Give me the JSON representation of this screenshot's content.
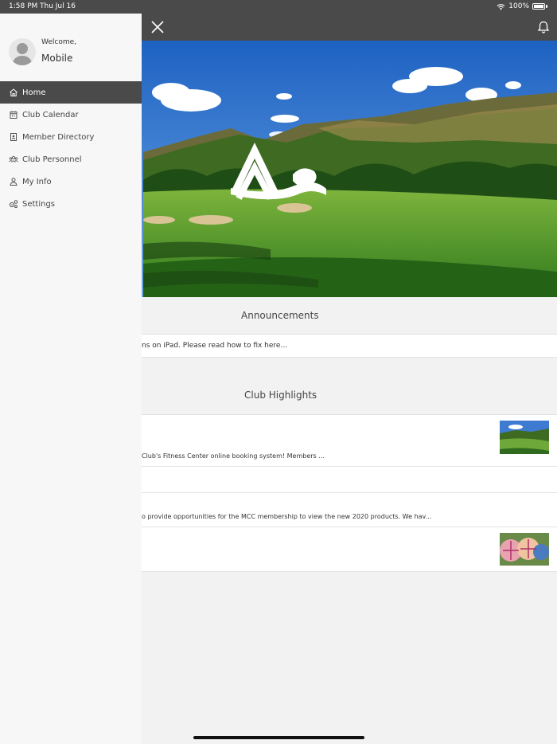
{
  "status_bar": {
    "time": "1:58 PM",
    "date": "Thu Jul 16",
    "battery": "100%"
  },
  "app_bar": {
    "close_icon": "close-icon",
    "notification_icon": "bell-icon"
  },
  "drawer": {
    "welcome": "Welcome,",
    "username": "Mobile",
    "items": [
      {
        "label": "Home",
        "icon": "home-icon",
        "active": true
      },
      {
        "label": "Club Calendar",
        "icon": "calendar-icon",
        "active": false
      },
      {
        "label": "Member Directory",
        "icon": "directory-icon",
        "active": false
      },
      {
        "label": "Club Personnel",
        "icon": "people-icon",
        "active": false
      },
      {
        "label": "My Info",
        "icon": "user-icon",
        "active": false
      },
      {
        "label": "Settings",
        "icon": "settings-icon",
        "active": false
      }
    ]
  },
  "announcements": {
    "title": "Announcements",
    "items": [
      "ns on iPad. Please read how to fix here..."
    ]
  },
  "highlights": {
    "title": "Club Highlights",
    "items": [
      {
        "text": "Club's Fitness Center online booking system! Members ..."
      },
      {
        "text": ""
      },
      {
        "text": "o provide opportunities for the MCC membership to view the new 2020 products. We hav..."
      },
      {
        "text": ""
      }
    ]
  },
  "colors": {
    "bar": "#4a4a4a",
    "drawer_bg": "#f7f7f7",
    "active_item": "#4a4a4a"
  }
}
